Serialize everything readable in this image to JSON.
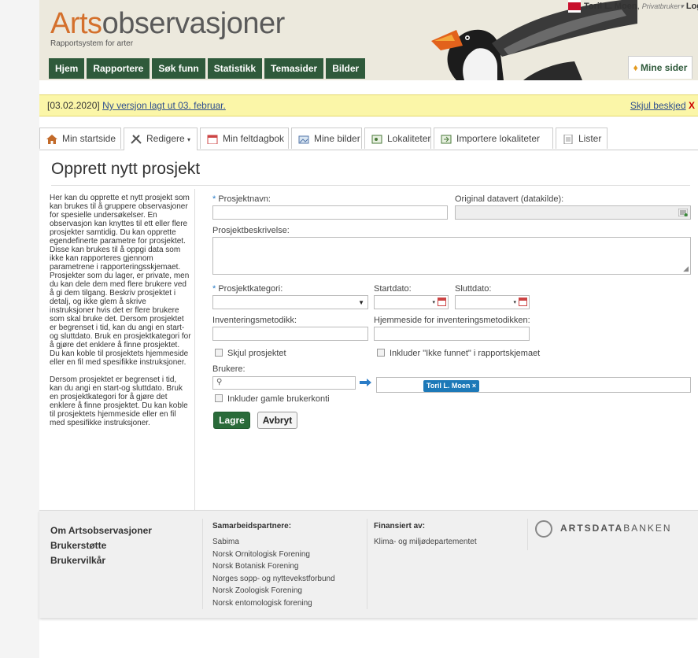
{
  "header": {
    "logo_prefix": "Arts",
    "logo_suffix": "observasjoner",
    "tagline": "Rapportsystem for arter",
    "user_name": "Toril L. Moen",
    "user_role": "Privatbruker",
    "logout_label": "Logg ut",
    "nav": [
      "Hjem",
      "Rapportere",
      "Søk funn",
      "Statistikk",
      "Temasider",
      "Bilder"
    ],
    "mine_sider": "Mine sider"
  },
  "notice": {
    "date": "[03.02.2020]",
    "link": "Ny versjon lagt ut 03. februar.",
    "hide_label": "Skjul beskjed",
    "hide_x": "X"
  },
  "tabs": [
    {
      "label": "Min startside",
      "icon": "home-icon"
    },
    {
      "label": "Redigere",
      "icon": "tools-icon"
    },
    {
      "label": "Min feltdagbok",
      "icon": "calendar-icon"
    },
    {
      "label": "Mine bilder",
      "icon": "images-icon"
    },
    {
      "label": "Lokaliteter",
      "icon": "map-icon"
    },
    {
      "label": "Importere lokaliteter",
      "icon": "import-icon"
    },
    {
      "label": "Lister",
      "icon": "document-icon"
    }
  ],
  "page_title": "Opprett nytt prosjekt",
  "help_text": [
    "Her kan du opprette et nytt prosjekt som kan brukes til å gruppere observasjoner for spesielle undersøkelser. En observasjon kan knyttes til ett eller flere prosjekter samtidig. Du kan opprette egendefinerte parametre for prosjektet. Disse kan brukes til å oppgi data som ikke kan rapporteres gjennom parametrene i rapporteringsskjemaet. Prosjekter som du lager, er private, men du kan dele dem med flere brukere ved å gi dem tilgang. Beskriv prosjektet i detalj, og ikke glem å skrive instruksjoner hvis det er flere brukere som skal bruke det. Dersom prosjektet er begrenset i tid, kan du angi en start- og sluttdato. Bruk en prosjektkategori for å gjøre det enklere å finne prosjektet. Du kan koble til prosjektets hjemmeside eller en fil med spesifikke instruksjoner.",
    "Dersom prosjektet er begrenset i tid, kan du angi en start-og sluttdato. Bruk en prosjektkategori for å gjøre det enklere å finne prosjektet. Du kan koble til prosjektets hjemmeside eller en fil med spesifikke instruksjoner."
  ],
  "form": {
    "required_mark": "*",
    "project_name_label": "Prosjektnavn:",
    "original_host_label": "Original datavert (datakilde):",
    "description_label": "Prosjektbeskrivelse:",
    "category_label": "Prosjektkategori:",
    "start_label": "Startdato:",
    "end_label": "Sluttdato:",
    "method_label": "Inventeringsmetodikk:",
    "method_home_label": "Hjemmeside for inventeringsmetodikken:",
    "hide_project_label": "Skjul prosjektet",
    "include_not_found_label": "Inkluder \"Ikke funnet\" i rapportskjemaet",
    "users_label": "Brukere:",
    "selected_user": "Toril L. Moen",
    "include_old_label": "Inkluder gamle brukerkonti",
    "save_label": "Lagre",
    "cancel_label": "Avbryt"
  },
  "footer": {
    "links": [
      "Om Artsobservasjoner",
      "Brukerstøtte",
      "Brukervilkår"
    ],
    "partners_title": "Samarbeidspartnere:",
    "partners": [
      "Sabima",
      "Norsk Ornitologisk Forening",
      "Norsk Botanisk Forening",
      "Norges sopp- og nyttevekstforbund",
      "Norsk Zoologisk Forening",
      "Norsk entomologisk forening"
    ],
    "funded_title": "Finansiert av:",
    "funded": [
      "Klima- og miljødepartementet"
    ],
    "brand_bold": "ARTSDATA",
    "brand_rest": "BANKEN"
  },
  "colors": {
    "nav_green": "#2f5a3b",
    "logo_orange": "#d4702c",
    "notice_yellow": "#fbf6a8",
    "link_blue": "#2f4f8f",
    "tag_blue": "#1d79b8"
  }
}
